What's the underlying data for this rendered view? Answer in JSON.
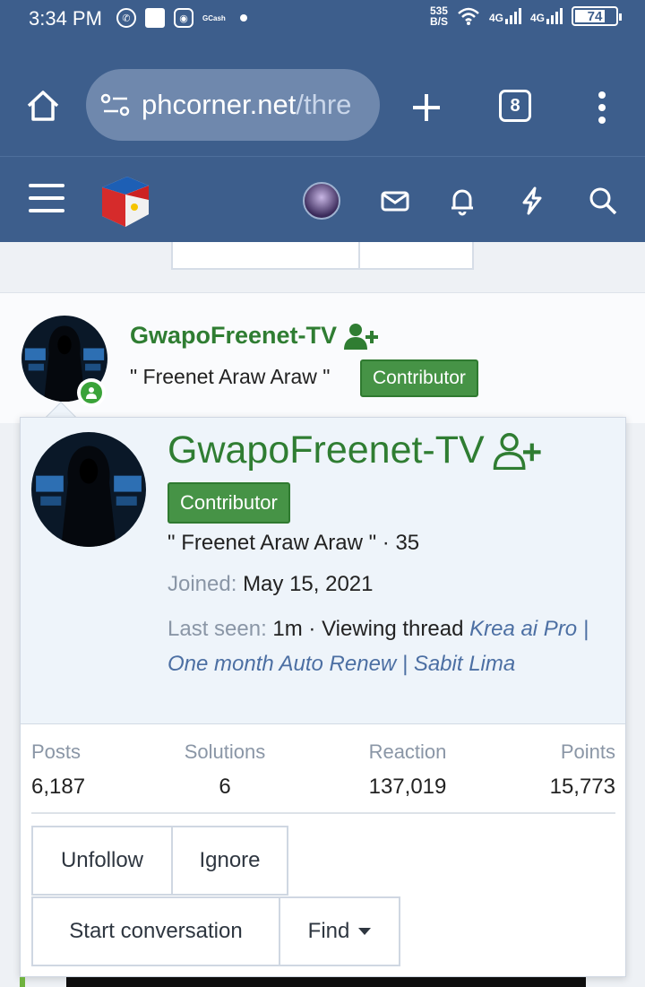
{
  "status_bar": {
    "time": "3:34 PM",
    "data_speed_value": "535",
    "data_speed_unit": "B/S",
    "network_1": "4G",
    "network_2": "4G",
    "battery": "74",
    "battery_level_percent": 74
  },
  "browser": {
    "url_domain": "phcorner.net",
    "url_path": "/thre",
    "tab_count": "8"
  },
  "post": {
    "username": "GwapoFreenet-TV",
    "user_title": "\" Freenet Araw Araw \"",
    "badge": "Contributor"
  },
  "profile_card": {
    "username": "GwapoFreenet-TV",
    "badge": "Contributor",
    "title_line": "\" Freenet Araw Araw \" · 35",
    "joined_label": "Joined:",
    "joined_value": "May 15, 2021",
    "last_seen_label": "Last seen:",
    "last_seen_value": "1m · Viewing thread",
    "thread_link": "Krea ai Pro | One month Auto Renew | Sabit Lima",
    "stats": [
      {
        "label": "Posts",
        "value": "6,187"
      },
      {
        "label": "Solutions",
        "value": "6"
      },
      {
        "label": "Reaction",
        "value": "137,019"
      },
      {
        "label": "Points",
        "value": "15,773"
      }
    ],
    "buttons": {
      "unfollow": "Unfollow",
      "ignore": "Ignore",
      "start_conversation": "Start conversation",
      "find": "Find"
    }
  },
  "colors": {
    "header_bg": "#3d5e8c",
    "username_green": "#2f7d32",
    "badge_green": "#469346",
    "link_blue": "#4c6fa3"
  }
}
